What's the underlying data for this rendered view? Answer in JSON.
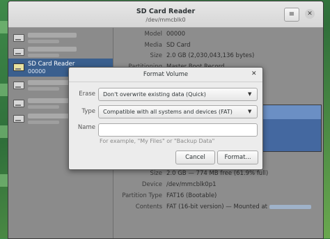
{
  "window": {
    "title": "SD Card Reader",
    "subtitle": "/dev/mmcblk0",
    "menu_icon": "hamburger-icon",
    "close_icon": "close-icon"
  },
  "sidebar": {
    "selected": {
      "name": "SD Card Reader",
      "size": "00000"
    }
  },
  "details": {
    "model_label": "Model",
    "model_value": "00000",
    "media_label": "Media",
    "media_value": "SD Card",
    "size_label": "Size",
    "size_value": "2.0 GB (2,030,043,136 bytes)",
    "partitioning_label": "Partitioning",
    "partitioning_value": "Master Boot Record",
    "vol_size_label": "Size",
    "vol_size_value": "2.0 GB — 774 MB free (61.9% full)",
    "device_label": "Device",
    "device_value": "/dev/mmcblk0p1",
    "ptype_label": "Partition Type",
    "ptype_value": "FAT16 (Bootable)",
    "contents_label": "Contents",
    "contents_value": "FAT (16-bit version) — Mounted at"
  },
  "dialog": {
    "title": "Format Volume",
    "erase_label": "Erase",
    "erase_value": "Don't overwrite existing data (Quick)",
    "type_label": "Type",
    "type_value": "Compatible with all systems and devices (FAT)",
    "name_label": "Name",
    "name_value": "",
    "name_hint": "For example, \"My Files\" or \"Backup Data\"",
    "cancel_label": "Cancel",
    "format_label": "Format..."
  },
  "colors": {
    "selection": "#3a5f8e",
    "volume_bar": "#4468a0"
  }
}
